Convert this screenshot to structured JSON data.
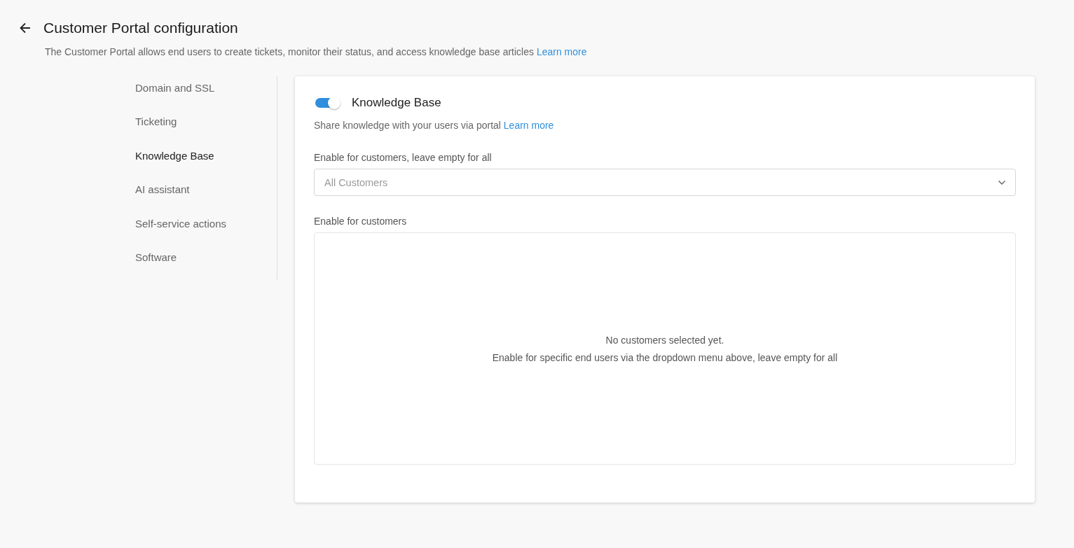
{
  "header": {
    "title": "Customer Portal configuration",
    "description": "The Customer Portal allows end users to create tickets, monitor their status, and access knowledge base articles",
    "link": "Learn more"
  },
  "sidebar": {
    "items": [
      {
        "label": "Domain and SSL",
        "selected": false
      },
      {
        "label": "Ticketing",
        "selected": false
      },
      {
        "label": "Knowledge Base",
        "selected": true
      },
      {
        "label": "AI assistant",
        "selected": false
      },
      {
        "label": "Self-service actions",
        "selected": false
      },
      {
        "label": "Software",
        "selected": false
      }
    ]
  },
  "panel": {
    "toggle": {
      "label": "Knowledge Base",
      "on": true
    },
    "description": "Share knowledge with your users via portal",
    "link": "Learn more",
    "dropdown_label": "Enable for customers, leave empty for all",
    "dropdown": {
      "placeholder": "All Customers"
    },
    "list_label": "Enable for customers",
    "empty_title": "No customers selected yet.",
    "empty_hint": "Enable for specific end users via the dropdown menu above, leave empty for all"
  }
}
